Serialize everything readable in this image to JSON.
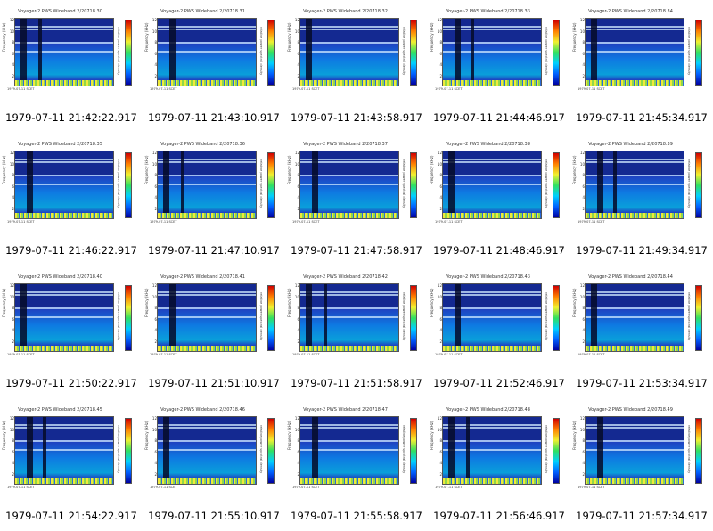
{
  "frames": [
    {
      "title": "Voyager-2 PWS Wideband 2/20718.30",
      "caption": "1979-07-11 21:42:22.917"
    },
    {
      "title": "Voyager-2 PWS Wideband 2/20718.31",
      "caption": "1979-07-11 21:43:10.917"
    },
    {
      "title": "Voyager-2 PWS Wideband 2/20718.32",
      "caption": "1979-07-11 21:43:58.917"
    },
    {
      "title": "Voyager-2 PWS Wideband 2/20718.33",
      "caption": "1979-07-11 21:44:46.917"
    },
    {
      "title": "Voyager-2 PWS Wideband 2/20718.34",
      "caption": "1979-07-11 21:45:34.917"
    },
    {
      "title": "Voyager-2 PWS Wideband 2/20718.35",
      "caption": "1979-07-11 21:46:22.917"
    },
    {
      "title": "Voyager-2 PWS Wideband 2/20718.36",
      "caption": "1979-07-11 21:47:10.917"
    },
    {
      "title": "Voyager-2 PWS Wideband 2/20718.37",
      "caption": "1979-07-11 21:47:58.917"
    },
    {
      "title": "Voyager-2 PWS Wideband 2/20718.38",
      "caption": "1979-07-11 21:48:46.917"
    },
    {
      "title": "Voyager-2 PWS Wideband 2/20718.39",
      "caption": "1979-07-11 21:49:34.917"
    },
    {
      "title": "Voyager-2 PWS Wideband 2/20718.40",
      "caption": "1979-07-11 21:50:22.917"
    },
    {
      "title": "Voyager-2 PWS Wideband 2/20718.41",
      "caption": "1979-07-11 21:51:10.917"
    },
    {
      "title": "Voyager-2 PWS Wideband 2/20718.42",
      "caption": "1979-07-11 21:51:58.917"
    },
    {
      "title": "Voyager-2 PWS Wideband 2/20718.43",
      "caption": "1979-07-11 21:52:46.917"
    },
    {
      "title": "Voyager-2 PWS Wideband 2/20718.44",
      "caption": "1979-07-11 21:53:34.917"
    },
    {
      "title": "Voyager-2 PWS Wideband 2/20718.45",
      "caption": "1979-07-11 21:54:22.917"
    },
    {
      "title": "Voyager-2 PWS Wideband 2/20718.46",
      "caption": "1979-07-11 21:55:10.917"
    },
    {
      "title": "Voyager-2 PWS Wideband 2/20718.47",
      "caption": "1979-07-11 21:55:58.917"
    },
    {
      "title": "Voyager-2 PWS Wideband 2/20718.48",
      "caption": "1979-07-11 21:56:46.917"
    },
    {
      "title": "Voyager-2 PWS Wideband 2/20718.49",
      "caption": "1979-07-11 21:57:34.917"
    }
  ],
  "panel": {
    "y_axis_label": "Frequency (kHz)",
    "y_ticks": [
      "12",
      "10",
      "8",
      "6",
      "4",
      "2"
    ],
    "colorbar_label": "relative power spectral density",
    "x_footer": "1979-07-11 SCET"
  },
  "colors": {
    "background": "#ffffff",
    "spectrogram_base": "#1f3fbf",
    "caption_text": "#000000"
  }
}
